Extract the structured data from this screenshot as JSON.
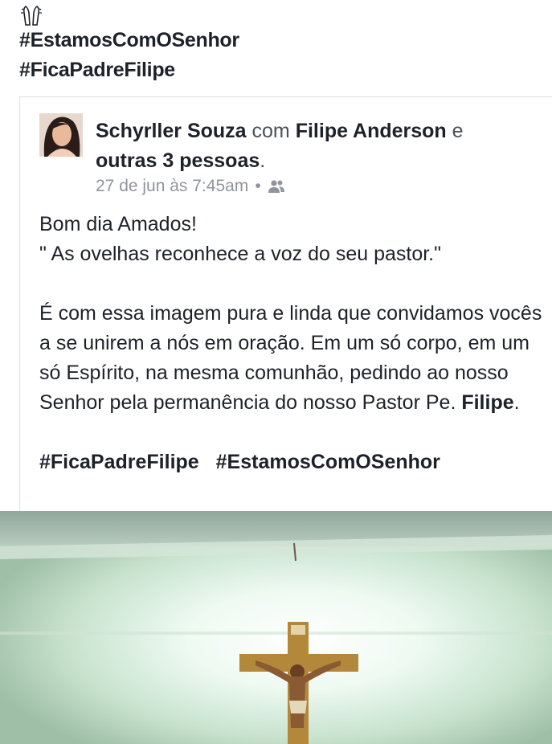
{
  "top": {
    "emoji_icon": "praying-hands-icon",
    "hashtags": [
      "#EstamosComOSenhor",
      "#FicaPadreFilipe"
    ]
  },
  "post": {
    "author": "Schyrller Souza",
    "with_word": "com",
    "tagged": "Filipe Anderson",
    "and_word": "e",
    "others": "outras 3 pessoas",
    "period": ".",
    "timestamp": "27 de jun às 7:45am",
    "separator": "•",
    "audience_icon": "friends-icon",
    "greeting": "Bom dia Amados!",
    "quote": "\" As ovelhas reconhece a voz do seu pastor.\"",
    "para_1": "É com essa imagem pura e linda que convidamos vocês a se unirem a nós em oração.  Em um só corpo, em um só Espírito, na mesma comunhão, pedindo ao nosso Senhor pela permanência do nosso Pastor Pe. ",
    "para_name": "Filipe",
    "para_end": ".",
    "hashtags": [
      "#FicaPadreFilipe",
      "#EstamosComOSenhor"
    ]
  },
  "photo": {
    "subject": "crucifix-image"
  }
}
